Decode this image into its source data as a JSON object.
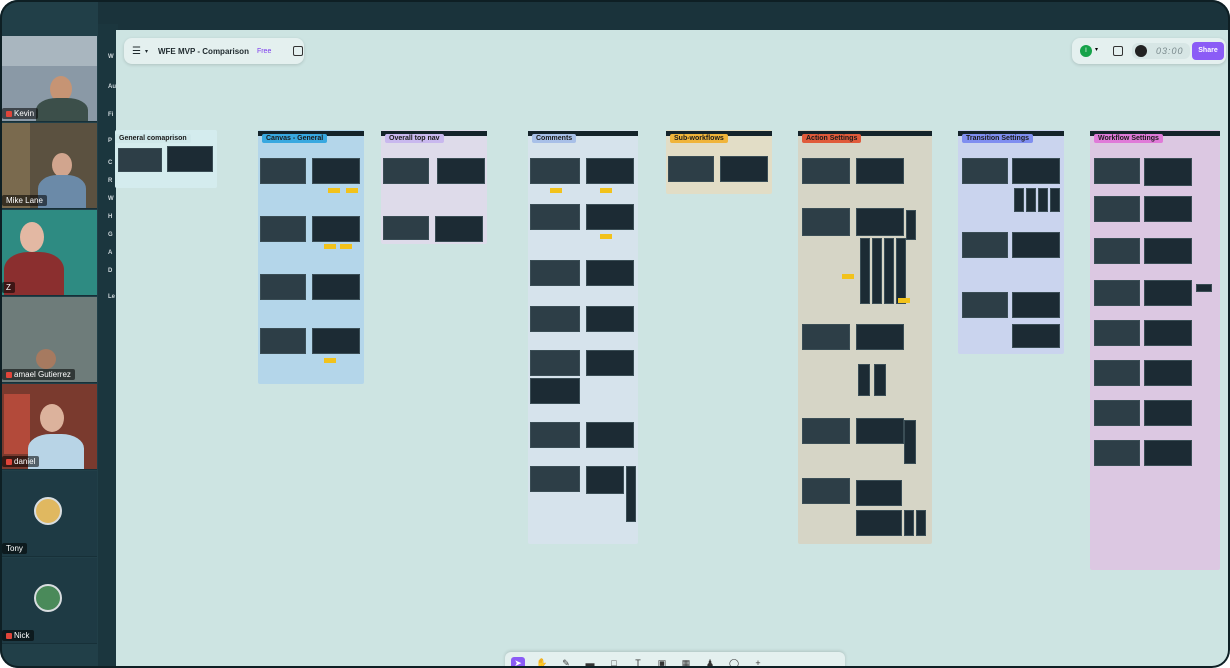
{
  "file": {
    "name": "WFE MVP - Comparison",
    "plan": "Free"
  },
  "header": {
    "timer": "03:00",
    "share_label": "Share",
    "user_initial": "I"
  },
  "participants": [
    {
      "name": "Kevin"
    },
    {
      "name": "Mike Lane"
    },
    {
      "name": "Z"
    },
    {
      "name": "amael Gutierrez"
    },
    {
      "name": "daniel"
    },
    {
      "name": "Tony"
    },
    {
      "name": "Nick"
    }
  ],
  "side_menu": [
    "W",
    "Au",
    "Fi",
    "P",
    "C",
    "R",
    "W",
    "H",
    "G",
    "A",
    "D",
    "Le"
  ],
  "frames": [
    {
      "title": "General comaprison",
      "color": "#d4ecee",
      "tag": "#cfe8ea"
    },
    {
      "title": "Canvas - General",
      "color": "#b4d6ea",
      "tag": "#38a8e0"
    },
    {
      "title": "Overall top nav",
      "color": "#dedbea",
      "tag": "#c9b8ee"
    },
    {
      "title": "Comments",
      "color": "#d6e3ec",
      "tag": "#a8c0e8"
    },
    {
      "title": "Sub-workflows",
      "color": "#e2ddc6",
      "tag": "#f0b43a"
    },
    {
      "title": "Action Settings",
      "color": "#d6d5c6",
      "tag": "#e05a3a"
    },
    {
      "title": "Transition Settings",
      "color": "#cad4ee",
      "tag": "#7f8ef0"
    },
    {
      "title": "Workflow Settings",
      "color": "#dcc8e2",
      "tag": "#e07ad8"
    }
  ],
  "colors": {
    "accent": "#8b5cf6",
    "canvas": "#cde4e2"
  },
  "toolbar": {
    "icons": [
      "move-tool",
      "hand-tool",
      "pen-tool",
      "shape-tool",
      "text-tool",
      "sticky-tool",
      "table-tool",
      "person-tool",
      "comment-tool",
      "more-tool"
    ]
  }
}
